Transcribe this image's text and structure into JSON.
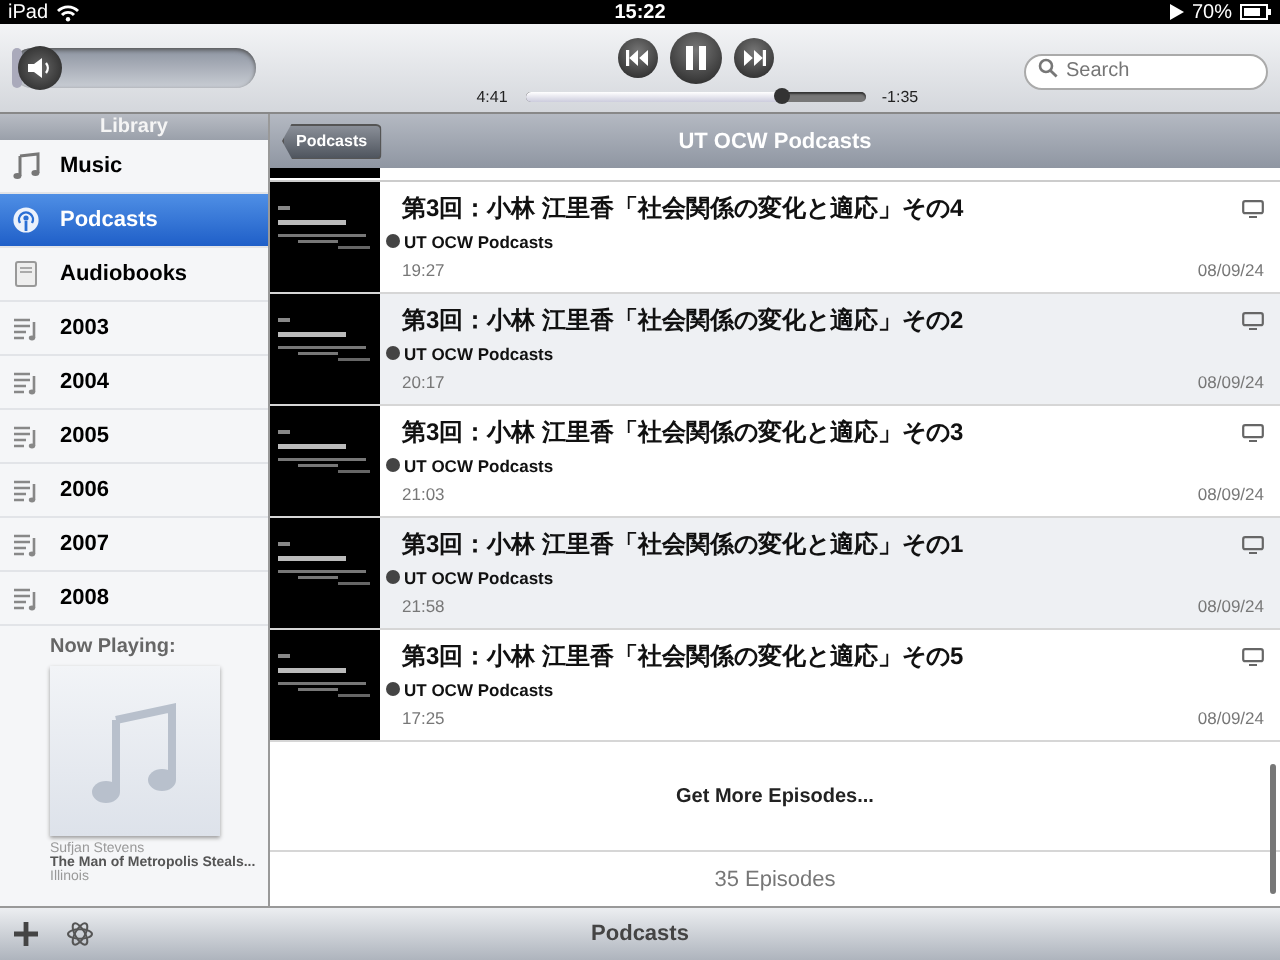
{
  "status_bar": {
    "device": "iPad",
    "time": "15:22",
    "battery": "70%"
  },
  "player": {
    "volume": {
      "level": 0.04
    },
    "elapsed": "4:41",
    "remaining": "-1:35",
    "progress": {
      "level": 0.75
    },
    "search": {
      "placeholder": "Search"
    }
  },
  "sidebar": {
    "title": "Library",
    "items": [
      {
        "label": "Music",
        "kind": "music",
        "selected": false
      },
      {
        "label": "Podcasts",
        "kind": "podcast",
        "selected": true
      },
      {
        "label": "Audiobooks",
        "kind": "audiobook",
        "selected": false
      },
      {
        "label": "2003",
        "kind": "playlist",
        "selected": false
      },
      {
        "label": "2004",
        "kind": "playlist",
        "selected": false
      },
      {
        "label": "2005",
        "kind": "playlist",
        "selected": false
      },
      {
        "label": "2006",
        "kind": "playlist",
        "selected": false
      },
      {
        "label": "2007",
        "kind": "playlist",
        "selected": false
      },
      {
        "label": "2008",
        "kind": "playlist",
        "selected": false
      }
    ],
    "now_playing": {
      "heading": "Now Playing:",
      "artist": "Sufjan Stevens",
      "title": "The Man of Metropolis Steals...",
      "album": "Illinois"
    }
  },
  "nav": {
    "back": "Podcasts",
    "title": "UT OCW Podcasts"
  },
  "episodes": [
    {
      "title": "第3回：小林 江里香「社会関係の変化と適応」その4",
      "channel": "UT OCW Podcasts",
      "duration": "19:27",
      "date": "08/09/24"
    },
    {
      "title": "第3回：小林 江里香「社会関係の変化と適応」その2",
      "channel": "UT OCW Podcasts",
      "duration": "20:17",
      "date": "08/09/24"
    },
    {
      "title": "第3回：小林 江里香「社会関係の変化と適応」その3",
      "channel": "UT OCW Podcasts",
      "duration": "21:03",
      "date": "08/09/24"
    },
    {
      "title": "第3回：小林 江里香「社会関係の変化と適応」その1",
      "channel": "UT OCW Podcasts",
      "duration": "21:58",
      "date": "08/09/24"
    },
    {
      "title": "第3回：小林 江里香「社会関係の変化と適応」その5",
      "channel": "UT OCW Podcasts",
      "duration": "17:25",
      "date": "08/09/24"
    }
  ],
  "more": "Get More Episodes...",
  "count": "35 Episodes",
  "bottom_bar": {
    "title": "Podcasts"
  }
}
